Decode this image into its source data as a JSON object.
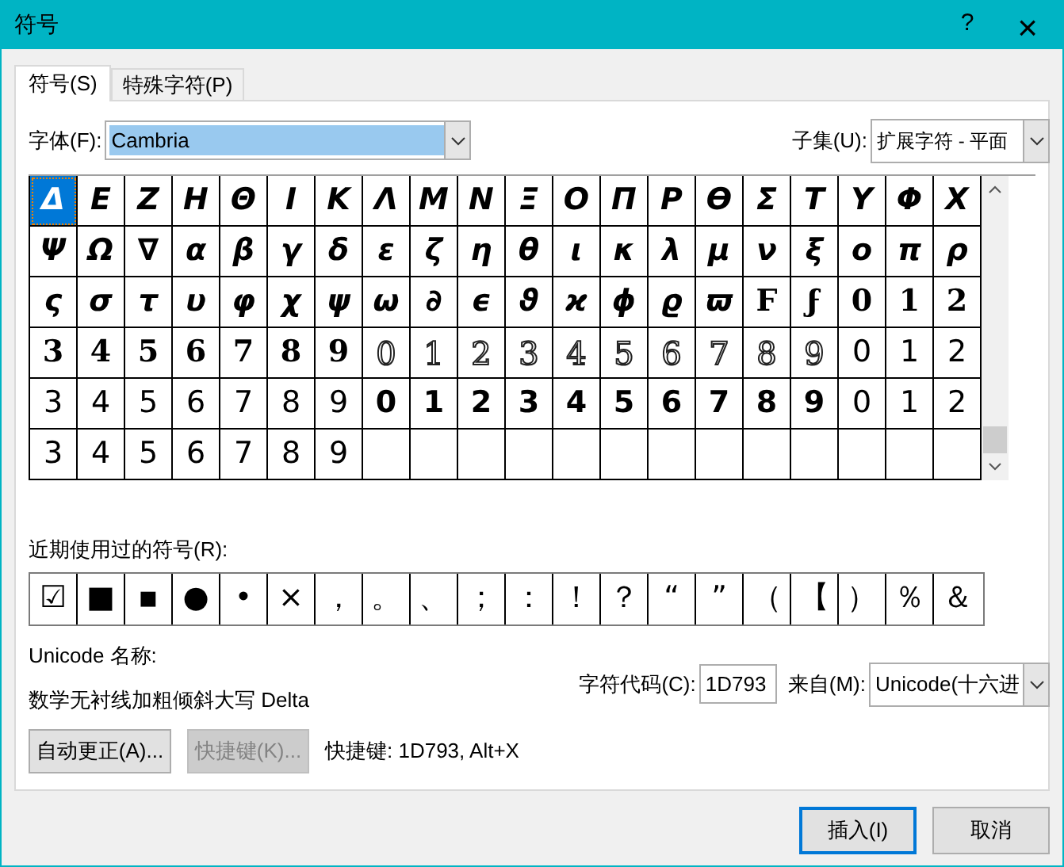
{
  "window": {
    "title": "符号",
    "help": "?",
    "close": "×"
  },
  "tabs": [
    {
      "label": "符号(S)",
      "selected": true
    },
    {
      "label": "特殊字符(P)",
      "selected": false
    }
  ],
  "font": {
    "label": "字体(F):",
    "value": "Cambria"
  },
  "subset": {
    "label": "子集(U):",
    "value": "扩展字符 - 平面"
  },
  "grid": [
    [
      {
        "c": "Δ",
        "kind": "italic",
        "selected": true
      },
      {
        "c": "E",
        "kind": "italic",
        "selected": false
      },
      {
        "c": "Z",
        "kind": "italic",
        "selected": false
      },
      {
        "c": "H",
        "kind": "italic",
        "selected": false
      },
      {
        "c": "Θ",
        "kind": "italic",
        "selected": false
      },
      {
        "c": "I",
        "kind": "italic",
        "selected": false
      },
      {
        "c": "K",
        "kind": "italic",
        "selected": false
      },
      {
        "c": "Λ",
        "kind": "italic",
        "selected": false
      },
      {
        "c": "M",
        "kind": "italic",
        "selected": false
      },
      {
        "c": "N",
        "kind": "italic",
        "selected": false
      },
      {
        "c": "Ξ",
        "kind": "italic",
        "selected": false
      },
      {
        "c": "O",
        "kind": "italic",
        "selected": false
      },
      {
        "c": "Π",
        "kind": "italic",
        "selected": false
      },
      {
        "c": "P",
        "kind": "italic",
        "selected": false
      },
      {
        "c": "ϴ",
        "kind": "italic",
        "selected": false
      },
      {
        "c": "Σ",
        "kind": "italic",
        "selected": false
      },
      {
        "c": "T",
        "kind": "italic",
        "selected": false
      },
      {
        "c": "Y",
        "kind": "italic",
        "selected": false
      },
      {
        "c": "Φ",
        "kind": "italic",
        "selected": false
      },
      {
        "c": "X",
        "kind": "italic",
        "selected": false
      }
    ],
    [
      {
        "c": "Ψ",
        "kind": "italic",
        "selected": false
      },
      {
        "c": "Ω",
        "kind": "italic",
        "selected": false
      },
      {
        "c": "∇",
        "kind": "italic",
        "selected": false
      },
      {
        "c": "α",
        "kind": "italic",
        "selected": false
      },
      {
        "c": "β",
        "kind": "italic",
        "selected": false
      },
      {
        "c": "γ",
        "kind": "italic",
        "selected": false
      },
      {
        "c": "δ",
        "kind": "italic",
        "selected": false
      },
      {
        "c": "ε",
        "kind": "italic",
        "selected": false
      },
      {
        "c": "ζ",
        "kind": "italic",
        "selected": false
      },
      {
        "c": "η",
        "kind": "italic",
        "selected": false
      },
      {
        "c": "θ",
        "kind": "italic",
        "selected": false
      },
      {
        "c": "ι",
        "kind": "italic",
        "selected": false
      },
      {
        "c": "κ",
        "kind": "italic",
        "selected": false
      },
      {
        "c": "λ",
        "kind": "italic",
        "selected": false
      },
      {
        "c": "μ",
        "kind": "italic",
        "selected": false
      },
      {
        "c": "ν",
        "kind": "italic",
        "selected": false
      },
      {
        "c": "ξ",
        "kind": "italic",
        "selected": false
      },
      {
        "c": "ο",
        "kind": "italic",
        "selected": false
      },
      {
        "c": "π",
        "kind": "italic",
        "selected": false
      },
      {
        "c": "ρ",
        "kind": "italic",
        "selected": false
      }
    ],
    [
      {
        "c": "ς",
        "kind": "italic",
        "selected": false
      },
      {
        "c": "σ",
        "kind": "italic",
        "selected": false
      },
      {
        "c": "τ",
        "kind": "italic",
        "selected": false
      },
      {
        "c": "υ",
        "kind": "italic",
        "selected": false
      },
      {
        "c": "φ",
        "kind": "italic",
        "selected": false
      },
      {
        "c": "χ",
        "kind": "italic",
        "selected": false
      },
      {
        "c": "ψ",
        "kind": "italic",
        "selected": false
      },
      {
        "c": "ω",
        "kind": "italic",
        "selected": false
      },
      {
        "c": "∂",
        "kind": "italic",
        "selected": false
      },
      {
        "c": "ϵ",
        "kind": "italic",
        "selected": false
      },
      {
        "c": "ϑ",
        "kind": "italic",
        "selected": false
      },
      {
        "c": "ϰ",
        "kind": "italic",
        "selected": false
      },
      {
        "c": "ϕ",
        "kind": "italic",
        "selected": false
      },
      {
        "c": "ϱ",
        "kind": "italic",
        "selected": false
      },
      {
        "c": "ϖ",
        "kind": "italic",
        "selected": false
      },
      {
        "c": "Ϝ",
        "kind": "serif",
        "selected": false
      },
      {
        "c": "ϝ",
        "kind": "serif",
        "selected": false
      },
      {
        "c": "0",
        "kind": "serif",
        "selected": false
      },
      {
        "c": "1",
        "kind": "serif",
        "selected": false
      },
      {
        "c": "2",
        "kind": "serif",
        "selected": false
      }
    ],
    [
      {
        "c": "3",
        "kind": "serif",
        "selected": false
      },
      {
        "c": "4",
        "kind": "serif",
        "selected": false
      },
      {
        "c": "5",
        "kind": "serif",
        "selected": false
      },
      {
        "c": "6",
        "kind": "serif",
        "selected": false
      },
      {
        "c": "7",
        "kind": "serif",
        "selected": false
      },
      {
        "c": "8",
        "kind": "serif",
        "selected": false
      },
      {
        "c": "9",
        "kind": "serif",
        "selected": false
      },
      {
        "c": "0",
        "kind": "outline",
        "selected": false
      },
      {
        "c": "1",
        "kind": "outline",
        "selected": false
      },
      {
        "c": "2",
        "kind": "outline",
        "selected": false
      },
      {
        "c": "3",
        "kind": "outline",
        "selected": false
      },
      {
        "c": "4",
        "kind": "outline",
        "selected": false
      },
      {
        "c": "5",
        "kind": "outline",
        "selected": false
      },
      {
        "c": "6",
        "kind": "outline",
        "selected": false
      },
      {
        "c": "7",
        "kind": "outline",
        "selected": false
      },
      {
        "c": "8",
        "kind": "outline",
        "selected": false
      },
      {
        "c": "9",
        "kind": "outline",
        "selected": false
      },
      {
        "c": "0",
        "kind": "sans",
        "selected": false
      },
      {
        "c": "1",
        "kind": "sans",
        "selected": false
      },
      {
        "c": "2",
        "kind": "sans",
        "selected": false
      }
    ],
    [
      {
        "c": "3",
        "kind": "sans",
        "selected": false
      },
      {
        "c": "4",
        "kind": "sans",
        "selected": false
      },
      {
        "c": "5",
        "kind": "sans",
        "selected": false
      },
      {
        "c": "6",
        "kind": "sans",
        "selected": false
      },
      {
        "c": "7",
        "kind": "sans",
        "selected": false
      },
      {
        "c": "8",
        "kind": "sans",
        "selected": false
      },
      {
        "c": "9",
        "kind": "sans",
        "selected": false
      },
      {
        "c": "0",
        "kind": "bold",
        "selected": false
      },
      {
        "c": "1",
        "kind": "bold",
        "selected": false
      },
      {
        "c": "2",
        "kind": "bold",
        "selected": false
      },
      {
        "c": "3",
        "kind": "bold",
        "selected": false
      },
      {
        "c": "4",
        "kind": "bold",
        "selected": false
      },
      {
        "c": "5",
        "kind": "bold",
        "selected": false
      },
      {
        "c": "6",
        "kind": "bold",
        "selected": false
      },
      {
        "c": "7",
        "kind": "bold",
        "selected": false
      },
      {
        "c": "8",
        "kind": "bold",
        "selected": false
      },
      {
        "c": "9",
        "kind": "bold",
        "selected": false
      },
      {
        "c": "0",
        "kind": "sans",
        "selected": false
      },
      {
        "c": "1",
        "kind": "sans",
        "selected": false
      },
      {
        "c": "2",
        "kind": "sans",
        "selected": false
      }
    ],
    [
      {
        "c": "3",
        "kind": "sans",
        "selected": false
      },
      {
        "c": "4",
        "kind": "sans",
        "selected": false
      },
      {
        "c": "5",
        "kind": "sans",
        "selected": false
      },
      {
        "c": "6",
        "kind": "sans",
        "selected": false
      },
      {
        "c": "7",
        "kind": "sans",
        "selected": false
      },
      {
        "c": "8",
        "kind": "sans",
        "selected": false
      },
      {
        "c": "9",
        "kind": "sans",
        "selected": false
      }
    ]
  ],
  "recent": {
    "label": "近期使用过的符号(R):",
    "symbols": [
      "☑",
      "■",
      "▪",
      "●",
      "•",
      "×",
      "，",
      "。",
      "、",
      "；",
      "：",
      "！",
      "？",
      "“",
      "”",
      "（",
      "【",
      "）",
      "％",
      "＆"
    ]
  },
  "unicode_name": {
    "label": "Unicode 名称:",
    "value": "数学无衬线加粗倾斜大写 Delta"
  },
  "char_code": {
    "label": "字符代码(C):",
    "value": "1D793"
  },
  "from": {
    "label": "来自(M):",
    "value": "Unicode(十六进"
  },
  "autocorrect_button": {
    "label": "自动更正(A)...",
    "disabled": false
  },
  "shortcut_button": {
    "label": "快捷键(K)...",
    "disabled": true
  },
  "shortcut_text": "快捷键: 1D793, Alt+X",
  "buttons": [
    {
      "label": "插入(I)",
      "default": true
    },
    {
      "label": "取消",
      "default": false
    }
  ]
}
